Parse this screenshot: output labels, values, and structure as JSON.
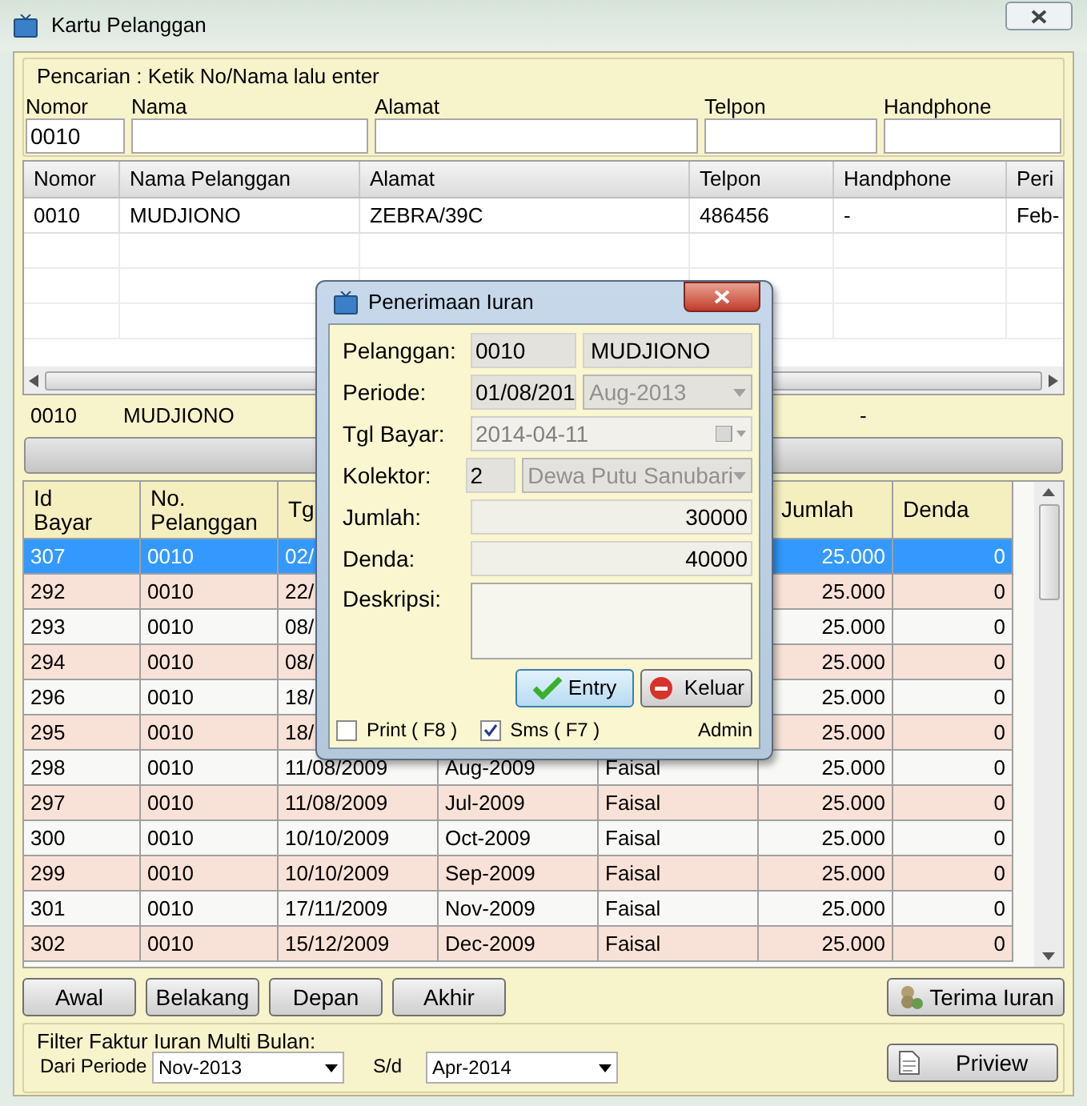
{
  "window": {
    "title": "Kartu Pelanggan"
  },
  "search": {
    "legend": "Pencarian : Ketik No/Nama lalu enter",
    "fields": [
      {
        "label": "Nomor",
        "value": "0010"
      },
      {
        "label": "Nama"
      },
      {
        "label": "Alamat"
      },
      {
        "label": "Telpon"
      },
      {
        "label": "Handphone"
      }
    ]
  },
  "customers": {
    "columns": [
      "Nomor",
      "Nama Pelanggan",
      "Alamat",
      "Telpon",
      "Handphone",
      "Peri"
    ],
    "rows": [
      {
        "cells": [
          "0010",
          "MUDJIONO",
          "ZEBRA/39C",
          "486456",
          "-",
          "Feb-"
        ]
      }
    ]
  },
  "info": [
    "0010",
    "MUDJIONO",
    "-"
  ],
  "payments": {
    "columns": [
      "Id Bayar",
      "No. Pelanggan",
      "Tg",
      null,
      null,
      "Jumlah",
      "Denda"
    ],
    "rows": [
      {
        "selected": true,
        "cells": [
          "307",
          "0010",
          "02/",
          null,
          null,
          "25.000",
          "0"
        ]
      },
      {
        "selected": false,
        "cells": [
          "292",
          "0010",
          "22/",
          null,
          null,
          "25.000",
          "0"
        ]
      },
      {
        "selected": false,
        "cells": [
          "293",
          "0010",
          "08/",
          null,
          null,
          "25.000",
          "0"
        ]
      },
      {
        "selected": false,
        "cells": [
          "294",
          "0010",
          "08/",
          null,
          null,
          "25.000",
          "0"
        ]
      },
      {
        "selected": false,
        "cells": [
          "296",
          "0010",
          "18/",
          null,
          null,
          "25.000",
          "0"
        ]
      },
      {
        "selected": false,
        "cells": [
          "295",
          "0010",
          "18/",
          null,
          null,
          "25.000",
          "0"
        ]
      },
      {
        "selected": false,
        "cells": [
          "298",
          "0010",
          "11/08/2009",
          "Aug-2009",
          "Faisal",
          "25.000",
          "0"
        ]
      },
      {
        "selected": false,
        "cells": [
          "297",
          "0010",
          "11/08/2009",
          "Jul-2009",
          "Faisal",
          "25.000",
          "0"
        ]
      },
      {
        "selected": false,
        "cells": [
          "300",
          "0010",
          "10/10/2009",
          "Oct-2009",
          "Faisal",
          "25.000",
          "0"
        ]
      },
      {
        "selected": false,
        "cells": [
          "299",
          "0010",
          "10/10/2009",
          "Sep-2009",
          "Faisal",
          "25.000",
          "0"
        ]
      },
      {
        "selected": false,
        "cells": [
          "301",
          "0010",
          "17/11/2009",
          "Nov-2009",
          "Faisal",
          "25.000",
          "0"
        ]
      },
      {
        "selected": false,
        "cells": [
          "302",
          "0010",
          "15/12/2009",
          "Dec-2009",
          "Faisal",
          "25.000",
          "0"
        ]
      }
    ]
  },
  "nav_buttons": [
    "Awal",
    "Belakang",
    "Depan",
    "Akhir"
  ],
  "receive_button": "Terima Iuran",
  "filter": {
    "legend": "Filter Faktur Iuran Multi Bulan:",
    "from_label": "Dari Periode",
    "from": "Nov-2013",
    "to_label": "S/d",
    "to": "Apr-2014",
    "preview_button": "Priview"
  },
  "dialog": {
    "title": "Penerimaan Iuran",
    "customer": {
      "label": "Pelanggan:",
      "code": "0010",
      "name": "MUDJIONO"
    },
    "period": {
      "label": "Periode:",
      "date": "01/08/201",
      "month": "Aug-2013",
      "disabled": true
    },
    "pay_date": {
      "label": "Tgl Bayar:",
      "value": "2014-04-11",
      "disabled": true
    },
    "collector": {
      "label": "Kolektor:",
      "code": "2",
      "name": "Dewa Putu Sanubari",
      "disabled": true
    },
    "amount": {
      "label": "Jumlah:",
      "value": "30000"
    },
    "fine": {
      "label": "Denda:",
      "value": "40000"
    },
    "description": {
      "label": "Deskripsi:"
    },
    "entry_button": "Entry",
    "exit_button": "Keluar",
    "checkboxes": [
      {
        "label": "Print ( F8 )",
        "checked": false
      },
      {
        "label": "Sms ( F7 )",
        "checked": true
      }
    ],
    "user": "Admin"
  }
}
